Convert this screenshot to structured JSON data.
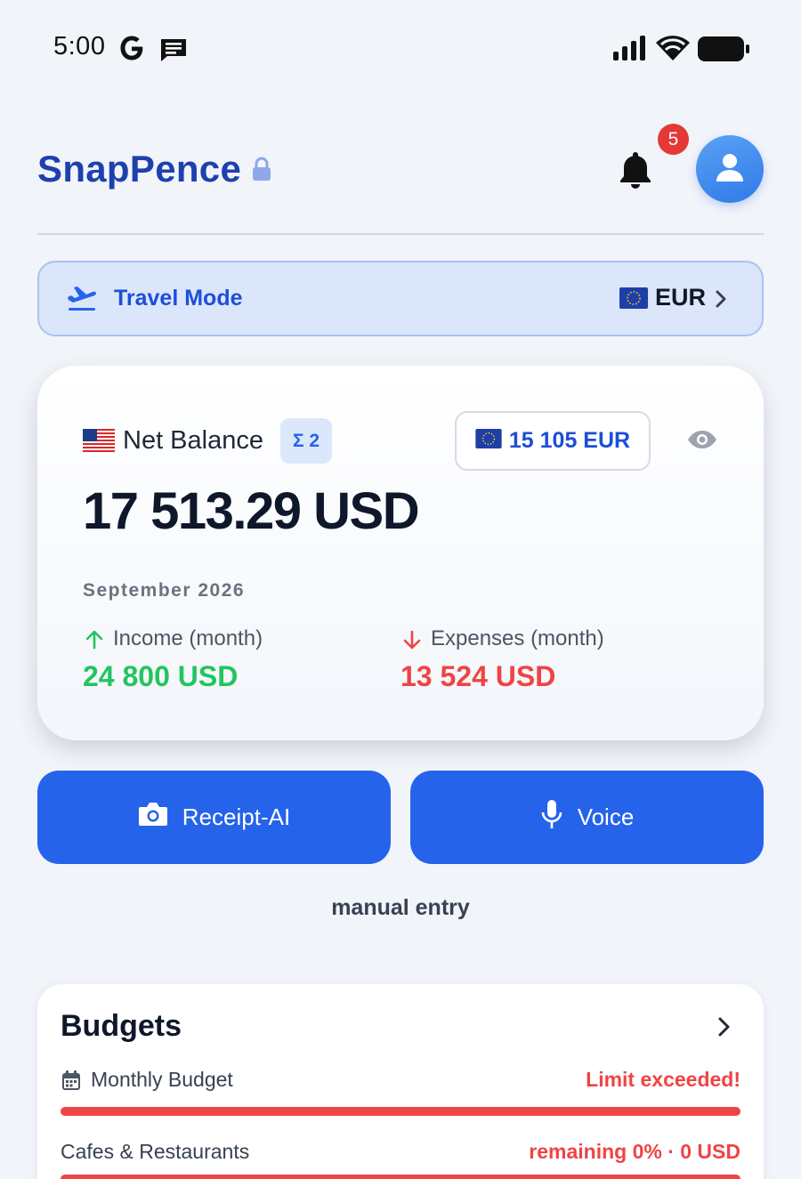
{
  "status_bar": {
    "time": "5:00",
    "icons": [
      "google-icon",
      "message-icon",
      "signal-icon",
      "wifi-icon",
      "battery-icon"
    ]
  },
  "header": {
    "app_title": "SnapPence",
    "notification_count": "5",
    "icons": [
      "lock-icon",
      "bell-icon",
      "user-icon"
    ]
  },
  "travel_mode": {
    "label": "Travel Mode",
    "currency": "EUR",
    "icons": [
      "airplane-icon",
      "eu-flag-icon",
      "chevron-right-icon"
    ]
  },
  "balance": {
    "label": "Net Balance",
    "sigma_count": "Σ 2",
    "converted_amount": "15 105 EUR",
    "amount": "17 513.29 USD",
    "month": "September 2026",
    "income_label": "Income (month)",
    "income_value": "24 800 USD",
    "expenses_label": "Expenses (month)",
    "expenses_value": "13 524 USD",
    "icons": [
      "us-flag-icon",
      "eu-flag-icon",
      "eye-icon",
      "arrow-up-icon",
      "arrow-down-icon"
    ]
  },
  "actions": {
    "receipt_label": "Receipt-AI",
    "voice_label": "Voice",
    "manual_entry": "manual entry",
    "icons": [
      "camera-icon",
      "microphone-icon"
    ]
  },
  "budgets": {
    "title": "Budgets",
    "items": [
      {
        "label": "Monthly Budget",
        "status": "Limit exceeded!",
        "progress": 1.0
      },
      {
        "label": "Cafes & Restaurants",
        "status": "remaining 0% · 0 USD",
        "progress": 1.0
      }
    ]
  },
  "colors": {
    "brand": "#1e40af",
    "primary": "#2563eb",
    "income": "#22c55e",
    "expense": "#ef4444",
    "badge": "#e53935",
    "background": "#f1f4f9"
  }
}
